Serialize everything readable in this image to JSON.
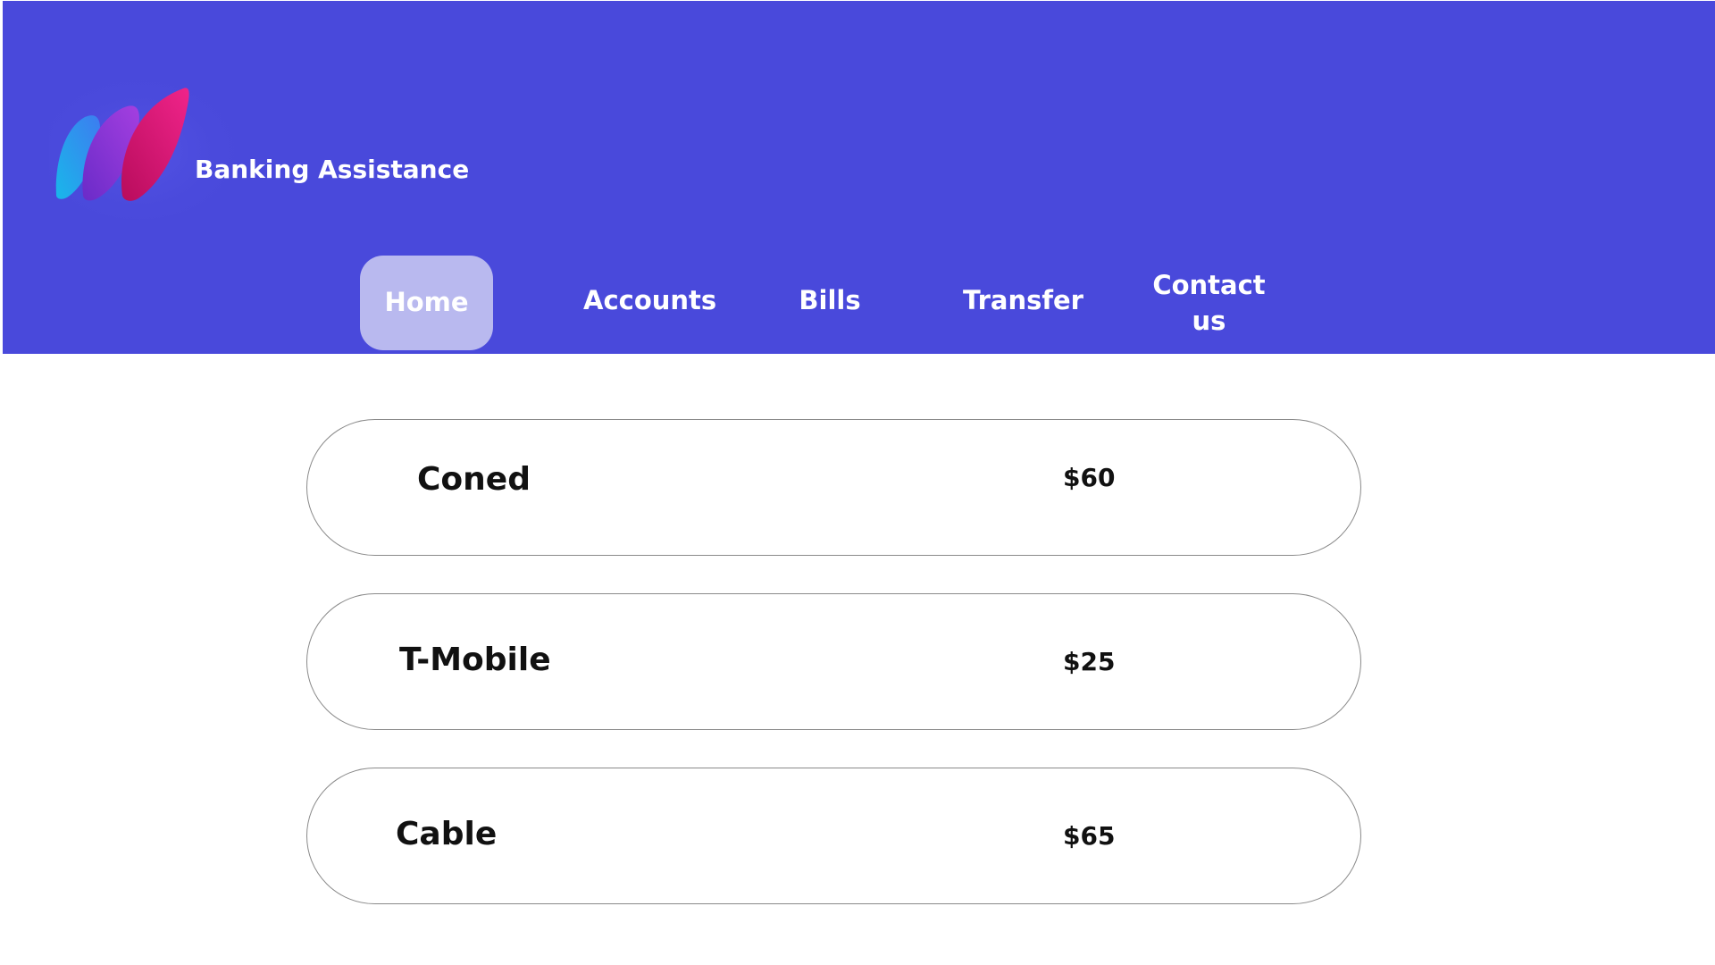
{
  "app": {
    "brand": "Banking Assistance"
  },
  "nav": {
    "items": [
      {
        "label": "Home",
        "active": true
      },
      {
        "label": "Accounts"
      },
      {
        "label": "Bills"
      },
      {
        "label": "Transfer"
      },
      {
        "label": "Contact us"
      }
    ]
  },
  "bills": [
    {
      "name": "Coned",
      "amount": "$60"
    },
    {
      "name": "T-Mobile",
      "amount": "$25"
    },
    {
      "name": "Cable",
      "amount": "$65"
    }
  ],
  "colors": {
    "header_bg": "#4949db",
    "active_nav_bg": "#b9b9ef",
    "card_border": "#8a8a8a",
    "text_dark": "#111111",
    "text_light": "#ffffff"
  },
  "icons": {
    "logo": "stylized-feather-logo"
  }
}
